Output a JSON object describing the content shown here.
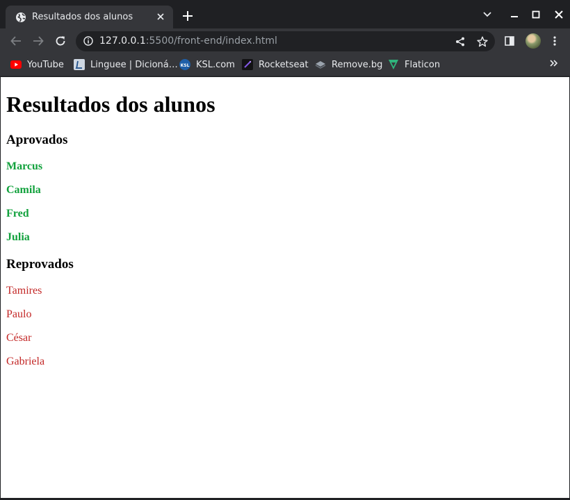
{
  "tab": {
    "title": "Resultados dos alunos",
    "favicon": "globe-icon"
  },
  "address_bar": {
    "host": "127.0.0.1",
    "path": ":5500/front-end/index.html"
  },
  "bookmarks": [
    {
      "label": "YouTube",
      "icon": "youtube-icon"
    },
    {
      "label": "Linguee | Dicioná…",
      "icon": "linguee-icon"
    },
    {
      "label": "KSL.com",
      "icon": "ksl-icon"
    },
    {
      "label": "Rocketseat",
      "icon": "rocketseat-icon"
    },
    {
      "label": "Remove.bg",
      "icon": "removebg-icon"
    },
    {
      "label": "Flaticon",
      "icon": "flaticon-icon"
    }
  ],
  "page": {
    "title": "Resultados dos alunos",
    "approved": {
      "heading": "Aprovados",
      "students": [
        "Marcus",
        "Camila",
        "Fred",
        "Julia"
      ],
      "color": "#11a13c"
    },
    "failed": {
      "heading": "Reprovados",
      "students": [
        "Tamires",
        "Paulo",
        "César",
        "Gabriela"
      ],
      "color": "#c32726"
    }
  },
  "colors": {
    "chrome_frame": "#1f2023",
    "chrome_toolbar": "#35363a",
    "omnibox": "#202124"
  }
}
